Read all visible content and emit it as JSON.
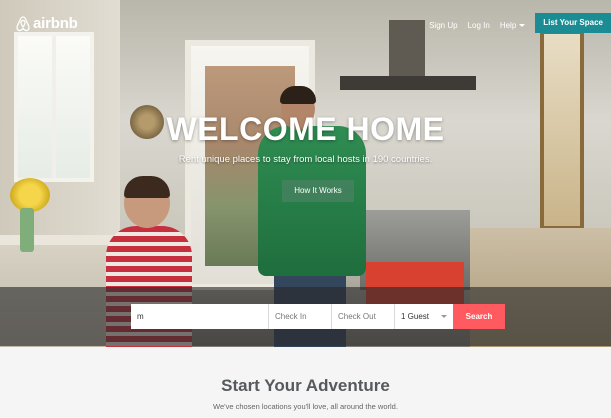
{
  "header": {
    "logo_text": "airbnb",
    "nav": {
      "sign_up": "Sign Up",
      "log_in": "Log In",
      "help": "Help",
      "list_space": "List Your Space"
    }
  },
  "hero": {
    "title": "WELCOME HOME",
    "subtitle": "Rent unique places to stay from local hosts in 190 countries.",
    "how_it_works": "How It Works"
  },
  "search": {
    "where_value": "m",
    "checkin_placeholder": "Check In",
    "checkout_placeholder": "Check Out",
    "guests_value": "1 Guest",
    "button": "Search"
  },
  "section": {
    "title": "Start Your Adventure",
    "subtitle": "We've chosen locations you'll love, all around the world."
  },
  "colors": {
    "brand": "#ff5a5f",
    "list_space": "#1b8c93",
    "how_it_works": "#48825e"
  },
  "icons": {
    "logo": "airbnb-belo-icon",
    "help_caret": "chevron-down-icon",
    "guests_caret": "chevron-down-icon"
  }
}
